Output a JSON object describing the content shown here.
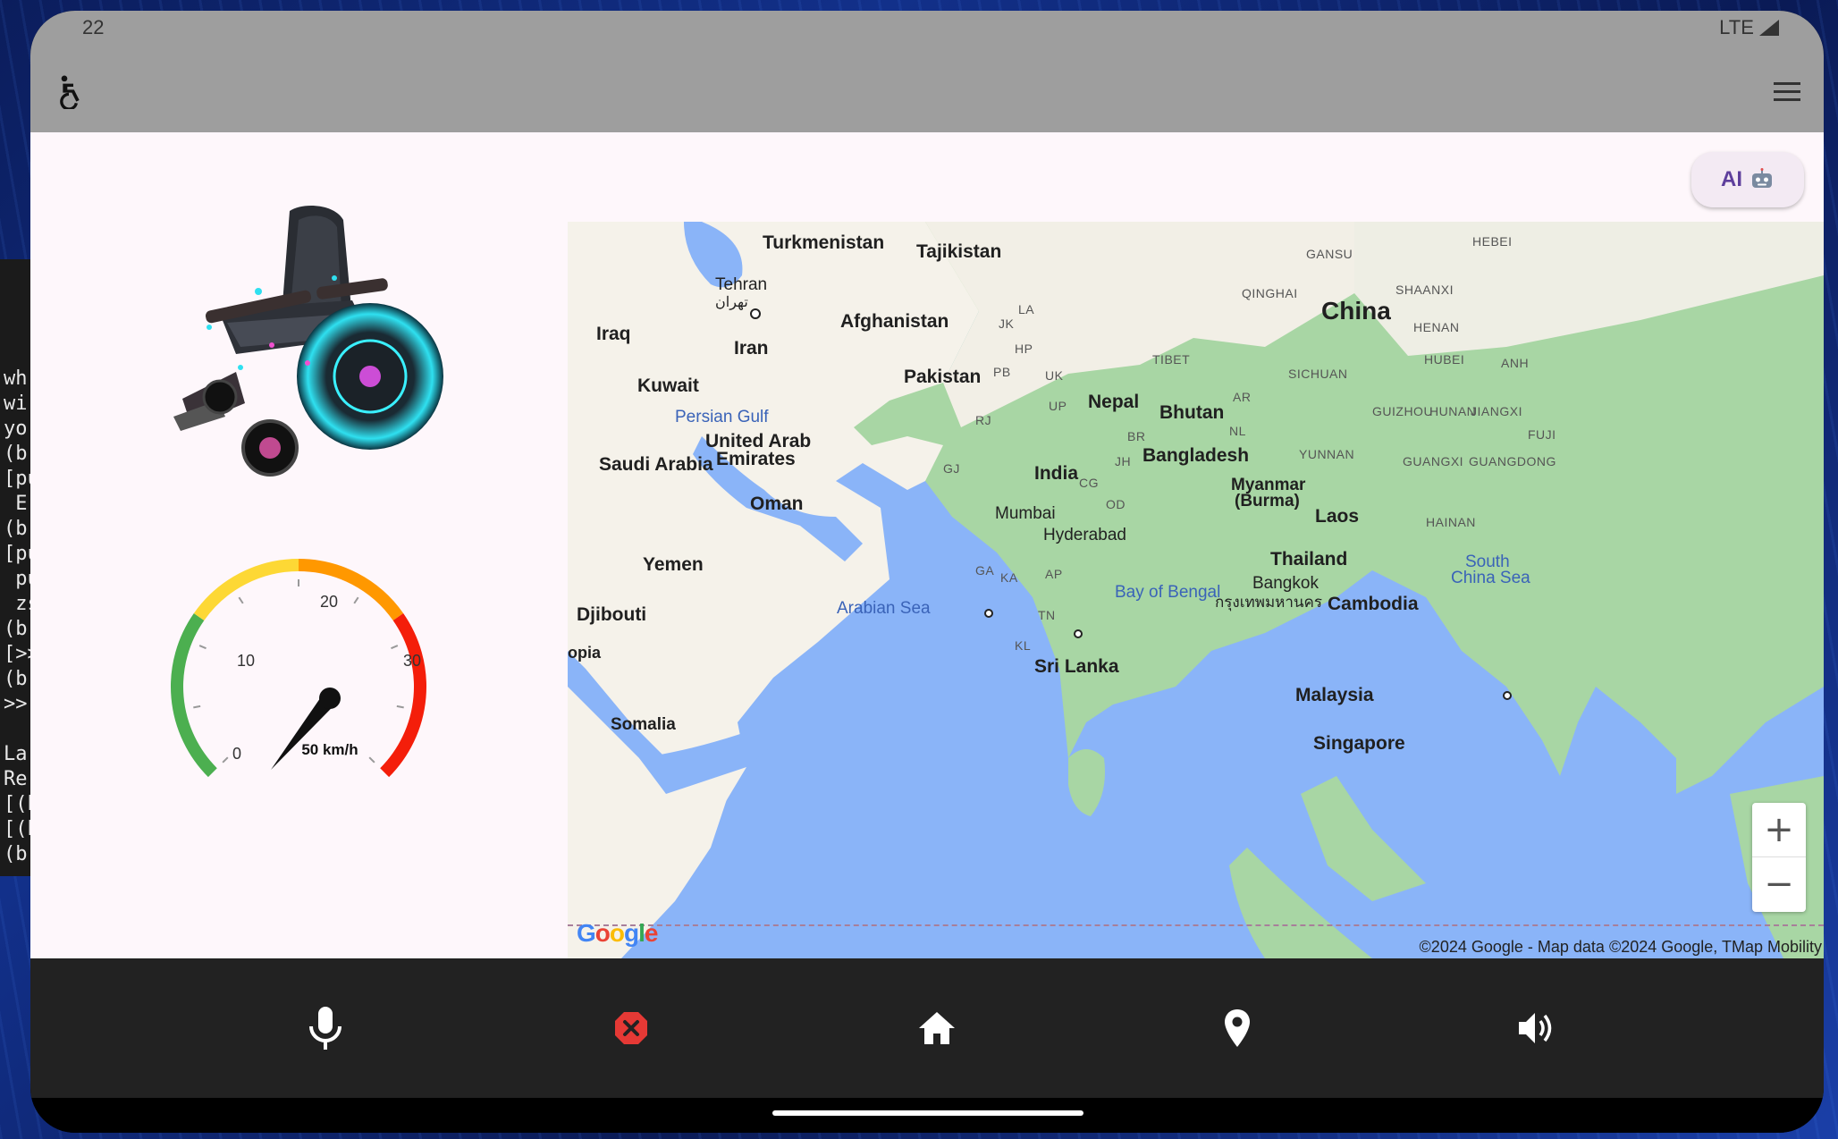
{
  "status_bar": {
    "left_text": "22",
    "right_text": "LTE"
  },
  "app_bar": {
    "icon": "wheelchair-icon",
    "menu_icon": "hamburger-menu-icon"
  },
  "ai_button": {
    "label": "AI",
    "icon": "robot-icon"
  },
  "speedometer": {
    "ticks": [
      "0",
      "10",
      "20",
      "30"
    ],
    "speed_label": "50 km/h",
    "needle_value": 4,
    "max": 40,
    "colors": {
      "green": "#4caf50",
      "yellow": "#fdd835",
      "orange": "#ff9800",
      "red": "#f41e0a"
    }
  },
  "map": {
    "labels": {
      "turkmenistan": "Turkmenistan",
      "tajikistan": "Tajikistan",
      "tehran": "Tehran",
      "tehran_fa": "تهران",
      "iraq": "Iraq",
      "iran": "Iran",
      "afghanistan": "Afghanistan",
      "pakistan": "Pakistan",
      "kuwait": "Kuwait",
      "persian_gulf": "Persian Gulf",
      "uae_1": "United Arab",
      "uae_2": "Emirates",
      "saudi": "Saudi Arabia",
      "oman": "Oman",
      "yemen": "Yemen",
      "djibouti": "Djibouti",
      "ethiopia": "opia",
      "somalia": "Somalia",
      "arabian_sea": "Arabian Sea",
      "india": "India",
      "mumbai": "Mumbai",
      "hyderabad": "Hyderabad",
      "sri_lanka": "Sri Lanka",
      "nepal": "Nepal",
      "bhutan": "Bhutan",
      "bangladesh": "Bangladesh",
      "bay_bengal": "Bay of Bengal",
      "myanmar_1": "Myanmar",
      "myanmar_2": "(Burma)",
      "laos": "Laos",
      "thailand": "Thailand",
      "bangkok": "Bangkok",
      "bangkok_th": "กรุงเทพมหานคร",
      "cambodia": "Cambodia",
      "malaysia": "Malaysia",
      "singapore": "Singapore",
      "china": "China",
      "south_china_sea_1": "South",
      "south_china_sea_2": "China Sea",
      "tibet": "TIBET",
      "qinghai": "QINGHAI",
      "gansu": "GANSU",
      "hebei": "HEBEI",
      "shaanxi": "SHAANXI",
      "henan": "HENAN",
      "hubei": "HUBEI",
      "anh": "ANH",
      "sichuan": "SICHUAN",
      "guizhou": "GUIZHOU",
      "hunan": "HUNAN",
      "jiangxi": "JIANGXI",
      "fuji": "FUJI",
      "yunnan": "YUNNAN",
      "guangxi": "GUANGXI",
      "guangdong": "GUANGDONG",
      "hainan": "HAINAN",
      "la": "LA",
      "jk": "JK",
      "hp": "HP",
      "pb": "PB",
      "uk": "UK",
      "up": "UP",
      "rj": "RJ",
      "br": "BR",
      "jh": "JH",
      "gj": "GJ",
      "cg": "CG",
      "od": "OD",
      "ar": "AR",
      "nl": "NL",
      "ga": "GA",
      "ka": "KA",
      "ap": "AP",
      "tn": "TN",
      "kl": "KL"
    },
    "zoom_in": "+",
    "zoom_out": "−",
    "logo": "Google",
    "attribution": "©2024 Google - Map data ©2024 Google, TMap Mobility"
  },
  "bottom_nav": [
    {
      "icon": "microphone-icon"
    },
    {
      "icon": "cancel-icon",
      "color": "#e53935"
    },
    {
      "icon": "home-icon"
    },
    {
      "icon": "location-pin-icon"
    },
    {
      "icon": "volume-icon"
    }
  ],
  "terminal_lines": [
    "wh",
    "wi",
    "yo",
    "(b",
    "[pu",
    " Er",
    "(b",
    "[pu",
    " pu",
    " zs",
    "(b",
    "[>>",
    "(b",
    ">>",
    "",
    "La",
    "Re",
    "[(b",
    "[(b",
    "(b"
  ]
}
